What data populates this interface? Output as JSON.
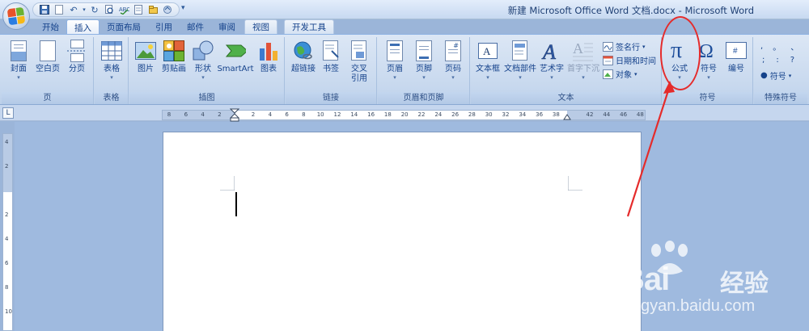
{
  "window": {
    "title": "新建 Microsoft Office Word 文档.docx - Microsoft Word"
  },
  "quick_access": [
    "save-icon",
    "undo-icon",
    "redo-icon",
    "print-preview-icon",
    "spelling-icon",
    "new-icon",
    "open-icon",
    "customize-icon"
  ],
  "tabs": [
    {
      "label": "开始"
    },
    {
      "label": "插入",
      "active": true
    },
    {
      "label": "页面布局"
    },
    {
      "label": "引用"
    },
    {
      "label": "邮件"
    },
    {
      "label": "审阅"
    },
    {
      "label": "视图"
    },
    {
      "label": "开发工具"
    }
  ],
  "groups": {
    "pages": {
      "label": "页",
      "cover": "封面",
      "blank": "空白页",
      "break": "分页"
    },
    "tables": {
      "label": "表格",
      "table": "表格"
    },
    "illustrations": {
      "label": "插图",
      "picture": "图片",
      "clipart": "剪贴画",
      "shapes": "形状",
      "smartart": "SmartArt",
      "chart": "图表"
    },
    "links": {
      "label": "链接",
      "hyperlink": "超链接",
      "bookmark": "书签",
      "crossref": "交叉\n引用"
    },
    "header_footer": {
      "label": "页眉和页脚",
      "header": "页眉",
      "footer": "页脚",
      "page_number": "页码"
    },
    "text": {
      "label": "文本",
      "textbox": "文本框",
      "quickparts": "文档部件",
      "wordart": "艺术字",
      "dropcap": "首字下沉",
      "signature": "签名行",
      "datetime": "日期和时间",
      "object": "对象"
    },
    "symbols": {
      "label": "符号",
      "equation": "公式",
      "symbol": "符号",
      "number": "编号"
    },
    "special": {
      "label": "特殊符号",
      "symbol": "符号"
    }
  },
  "ruler": {
    "numbers": [
      "8",
      "6",
      "4",
      "2",
      "",
      "2",
      "4",
      "6",
      "8",
      "10",
      "12",
      "14",
      "16",
      "18",
      "20",
      "22",
      "24",
      "26",
      "28",
      "30",
      "32",
      "34",
      "36",
      "38",
      "",
      "42",
      "44",
      "46",
      "48"
    ]
  },
  "vruler": {
    "numbers": [
      "4",
      "2",
      "",
      "2",
      "4",
      "6",
      "8",
      "10"
    ]
  },
  "watermark": {
    "brand": "Bai",
    "cn": "经验",
    "url": "jingyan.baidu.com"
  },
  "colors": {
    "annotation": "#e52b2b",
    "ribbon": "#dce7f5",
    "workspace": "#9fbadf"
  }
}
